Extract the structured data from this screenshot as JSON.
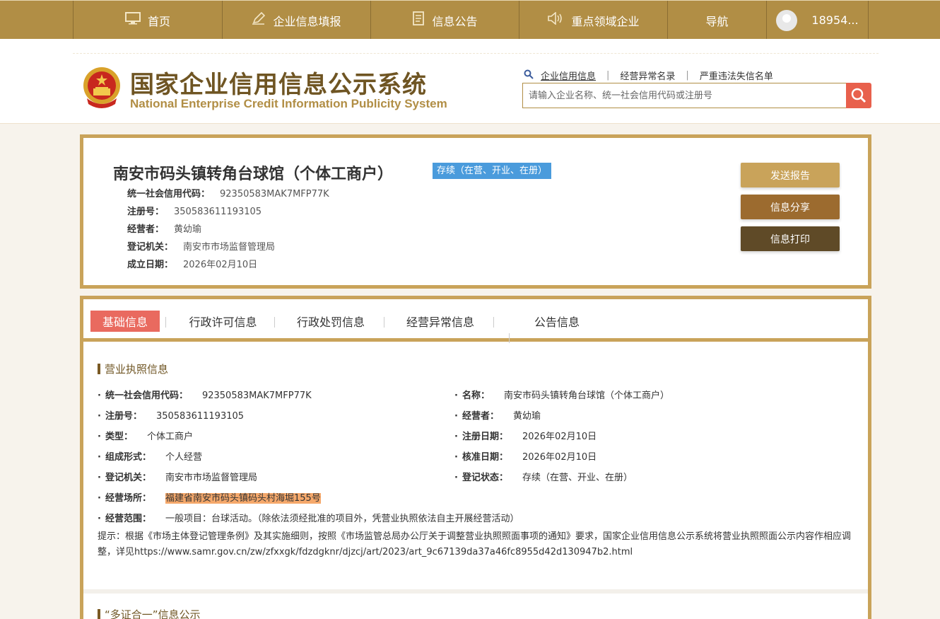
{
  "nav": {
    "items": [
      {
        "label": "首页",
        "icon": "monitor-icon"
      },
      {
        "label": "企业信息填报",
        "icon": "pen-icon"
      },
      {
        "label": "信息公告",
        "icon": "document-icon"
      },
      {
        "label": "重点领域企业",
        "icon": "speaker-icon"
      },
      {
        "label": "导航",
        "icon": ""
      }
    ],
    "user": "18954..."
  },
  "header": {
    "title_cn": "国家企业信用信息公示系统",
    "title_en": "National Enterprise Credit Information Publicity System",
    "search_links": [
      "企业信用信息",
      "经营异常名录",
      "严重违法失信名单"
    ],
    "search_placeholder": "请输入企业名称、统一社会信用代码或注册号"
  },
  "summary": {
    "name": "南安市码头镇转角台球馆（个体工商户）",
    "status": "存续（在营、开业、在册）",
    "rows": [
      {
        "label": "统一社会信用代码：",
        "value": "92350583MAK7MFP77K"
      },
      {
        "label": "注册号：",
        "value": "350583611193105"
      },
      {
        "label": "经营者：",
        "value": "黄幼瑜"
      },
      {
        "label": "登记机关：",
        "value": "南安市市场监督管理局"
      },
      {
        "label": "成立日期：",
        "value": "2026年02月10日"
      }
    ],
    "buttons": [
      "发送报告",
      "信息分享",
      "信息打印"
    ]
  },
  "tabs": [
    "基础信息",
    "行政许可信息",
    "行政处罚信息",
    "经营异常信息",
    "公告信息"
  ],
  "license": {
    "title": "营业执照信息",
    "left": [
      {
        "label": "统一社会信用代码：",
        "value": "92350583MAK7MFP77K"
      },
      {
        "label": "注册号：",
        "value": "350583611193105"
      },
      {
        "label": "类型：",
        "value": "个体工商户"
      },
      {
        "label": "组成形式：",
        "value": "个人经营"
      },
      {
        "label": "登记机关：",
        "value": "南安市市场监督管理局"
      },
      {
        "label": "经营场所：",
        "value": "福建省南安市码头镇码头村海堀155号"
      },
      {
        "label": "经营范围：",
        "value": "一般项目：台球活动。（除依法须经批准的项目外，凭营业执照依法自主开展经营活动）"
      }
    ],
    "right": [
      {
        "label": "名称：",
        "value": "南安市码头镇转角台球馆（个体工商户）"
      },
      {
        "label": "经营者：",
        "value": "黄幼瑜"
      },
      {
        "label": "注册日期：",
        "value": "2026年02月10日"
      },
      {
        "label": "核准日期：",
        "value": "2026年02月10日"
      },
      {
        "label": "登记状态：",
        "value": "存续（在营、开业、在册）"
      }
    ],
    "tip": "提示：根据《市场主体登记管理条例》及其实施细则，按照《市场监管总局办公厅关于调整营业执照照面事项的通知》要求，国家企业信用信息公示系统将营业执照照面公示内容作相应调整，详见https://www.samr.gov.cn/zw/zfxxgk/fdzdgknr/djzcj/art/2023/art_9c67139da37a46fc8955d42d130947b2.html"
  },
  "next_section": {
    "title": "“多证合一”信息公示"
  },
  "colors": {
    "gold": "#b18e45",
    "border": "#c9a35a",
    "active_tab": "#e96a5f",
    "status": "#4a9bdc",
    "highlight": "#f5a86b"
  }
}
